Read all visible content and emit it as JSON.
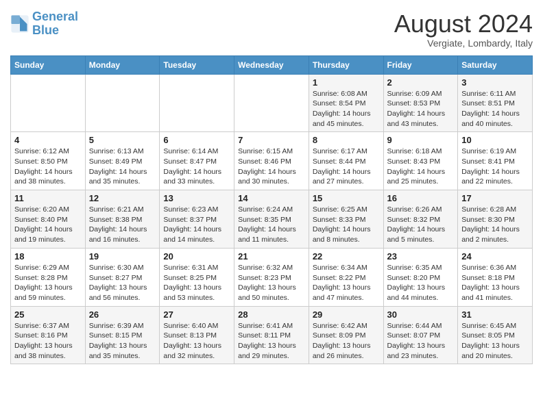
{
  "logo": {
    "line1": "General",
    "line2": "Blue"
  },
  "title": "August 2024",
  "location": "Vergiate, Lombardy, Italy",
  "weekdays": [
    "Sunday",
    "Monday",
    "Tuesday",
    "Wednesday",
    "Thursday",
    "Friday",
    "Saturday"
  ],
  "weeks": [
    [
      {
        "day": "",
        "info": ""
      },
      {
        "day": "",
        "info": ""
      },
      {
        "day": "",
        "info": ""
      },
      {
        "day": "",
        "info": ""
      },
      {
        "day": "1",
        "info": "Sunrise: 6:08 AM\nSunset: 8:54 PM\nDaylight: 14 hours and 45 minutes."
      },
      {
        "day": "2",
        "info": "Sunrise: 6:09 AM\nSunset: 8:53 PM\nDaylight: 14 hours and 43 minutes."
      },
      {
        "day": "3",
        "info": "Sunrise: 6:11 AM\nSunset: 8:51 PM\nDaylight: 14 hours and 40 minutes."
      }
    ],
    [
      {
        "day": "4",
        "info": "Sunrise: 6:12 AM\nSunset: 8:50 PM\nDaylight: 14 hours and 38 minutes."
      },
      {
        "day": "5",
        "info": "Sunrise: 6:13 AM\nSunset: 8:49 PM\nDaylight: 14 hours and 35 minutes."
      },
      {
        "day": "6",
        "info": "Sunrise: 6:14 AM\nSunset: 8:47 PM\nDaylight: 14 hours and 33 minutes."
      },
      {
        "day": "7",
        "info": "Sunrise: 6:15 AM\nSunset: 8:46 PM\nDaylight: 14 hours and 30 minutes."
      },
      {
        "day": "8",
        "info": "Sunrise: 6:17 AM\nSunset: 8:44 PM\nDaylight: 14 hours and 27 minutes."
      },
      {
        "day": "9",
        "info": "Sunrise: 6:18 AM\nSunset: 8:43 PM\nDaylight: 14 hours and 25 minutes."
      },
      {
        "day": "10",
        "info": "Sunrise: 6:19 AM\nSunset: 8:41 PM\nDaylight: 14 hours and 22 minutes."
      }
    ],
    [
      {
        "day": "11",
        "info": "Sunrise: 6:20 AM\nSunset: 8:40 PM\nDaylight: 14 hours and 19 minutes."
      },
      {
        "day": "12",
        "info": "Sunrise: 6:21 AM\nSunset: 8:38 PM\nDaylight: 14 hours and 16 minutes."
      },
      {
        "day": "13",
        "info": "Sunrise: 6:23 AM\nSunset: 8:37 PM\nDaylight: 14 hours and 14 minutes."
      },
      {
        "day": "14",
        "info": "Sunrise: 6:24 AM\nSunset: 8:35 PM\nDaylight: 14 hours and 11 minutes."
      },
      {
        "day": "15",
        "info": "Sunrise: 6:25 AM\nSunset: 8:33 PM\nDaylight: 14 hours and 8 minutes."
      },
      {
        "day": "16",
        "info": "Sunrise: 6:26 AM\nSunset: 8:32 PM\nDaylight: 14 hours and 5 minutes."
      },
      {
        "day": "17",
        "info": "Sunrise: 6:28 AM\nSunset: 8:30 PM\nDaylight: 14 hours and 2 minutes."
      }
    ],
    [
      {
        "day": "18",
        "info": "Sunrise: 6:29 AM\nSunset: 8:28 PM\nDaylight: 13 hours and 59 minutes."
      },
      {
        "day": "19",
        "info": "Sunrise: 6:30 AM\nSunset: 8:27 PM\nDaylight: 13 hours and 56 minutes."
      },
      {
        "day": "20",
        "info": "Sunrise: 6:31 AM\nSunset: 8:25 PM\nDaylight: 13 hours and 53 minutes."
      },
      {
        "day": "21",
        "info": "Sunrise: 6:32 AM\nSunset: 8:23 PM\nDaylight: 13 hours and 50 minutes."
      },
      {
        "day": "22",
        "info": "Sunrise: 6:34 AM\nSunset: 8:22 PM\nDaylight: 13 hours and 47 minutes."
      },
      {
        "day": "23",
        "info": "Sunrise: 6:35 AM\nSunset: 8:20 PM\nDaylight: 13 hours and 44 minutes."
      },
      {
        "day": "24",
        "info": "Sunrise: 6:36 AM\nSunset: 8:18 PM\nDaylight: 13 hours and 41 minutes."
      }
    ],
    [
      {
        "day": "25",
        "info": "Sunrise: 6:37 AM\nSunset: 8:16 PM\nDaylight: 13 hours and 38 minutes."
      },
      {
        "day": "26",
        "info": "Sunrise: 6:39 AM\nSunset: 8:15 PM\nDaylight: 13 hours and 35 minutes."
      },
      {
        "day": "27",
        "info": "Sunrise: 6:40 AM\nSunset: 8:13 PM\nDaylight: 13 hours and 32 minutes."
      },
      {
        "day": "28",
        "info": "Sunrise: 6:41 AM\nSunset: 8:11 PM\nDaylight: 13 hours and 29 minutes."
      },
      {
        "day": "29",
        "info": "Sunrise: 6:42 AM\nSunset: 8:09 PM\nDaylight: 13 hours and 26 minutes."
      },
      {
        "day": "30",
        "info": "Sunrise: 6:44 AM\nSunset: 8:07 PM\nDaylight: 13 hours and 23 minutes."
      },
      {
        "day": "31",
        "info": "Sunrise: 6:45 AM\nSunset: 8:05 PM\nDaylight: 13 hours and 20 minutes."
      }
    ]
  ]
}
